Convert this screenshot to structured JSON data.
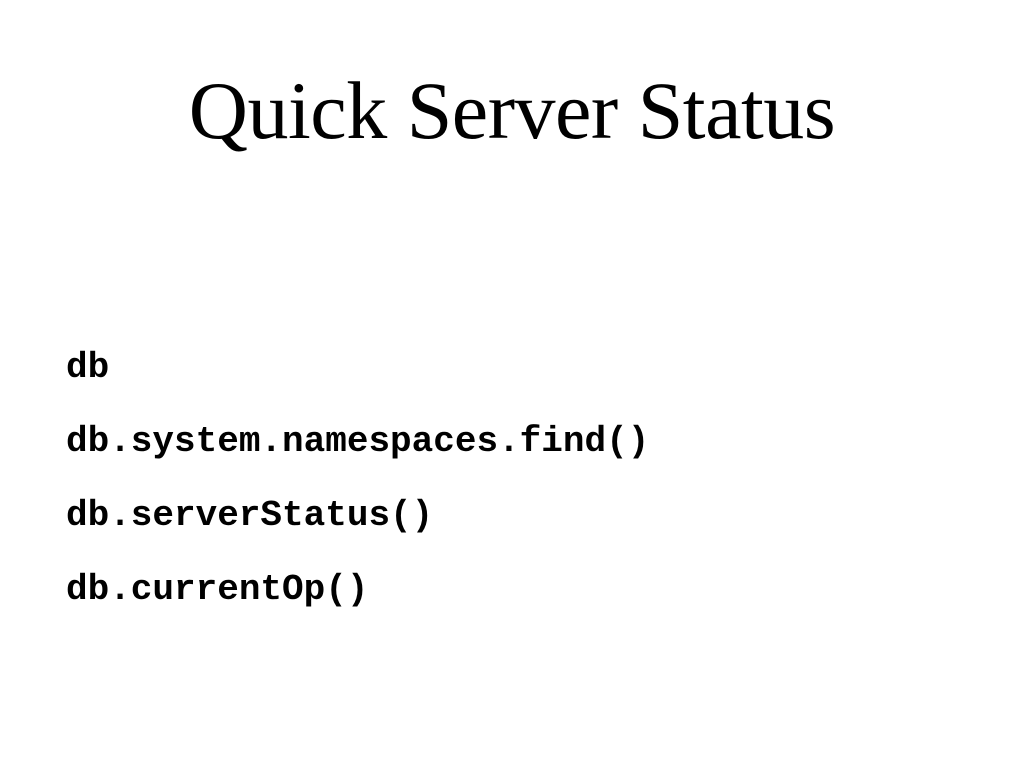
{
  "slide": {
    "title": "Quick Server Status",
    "commands": [
      "db",
      "db.system.namespaces.find()",
      "db.serverStatus()",
      "db.currentOp()"
    ]
  }
}
